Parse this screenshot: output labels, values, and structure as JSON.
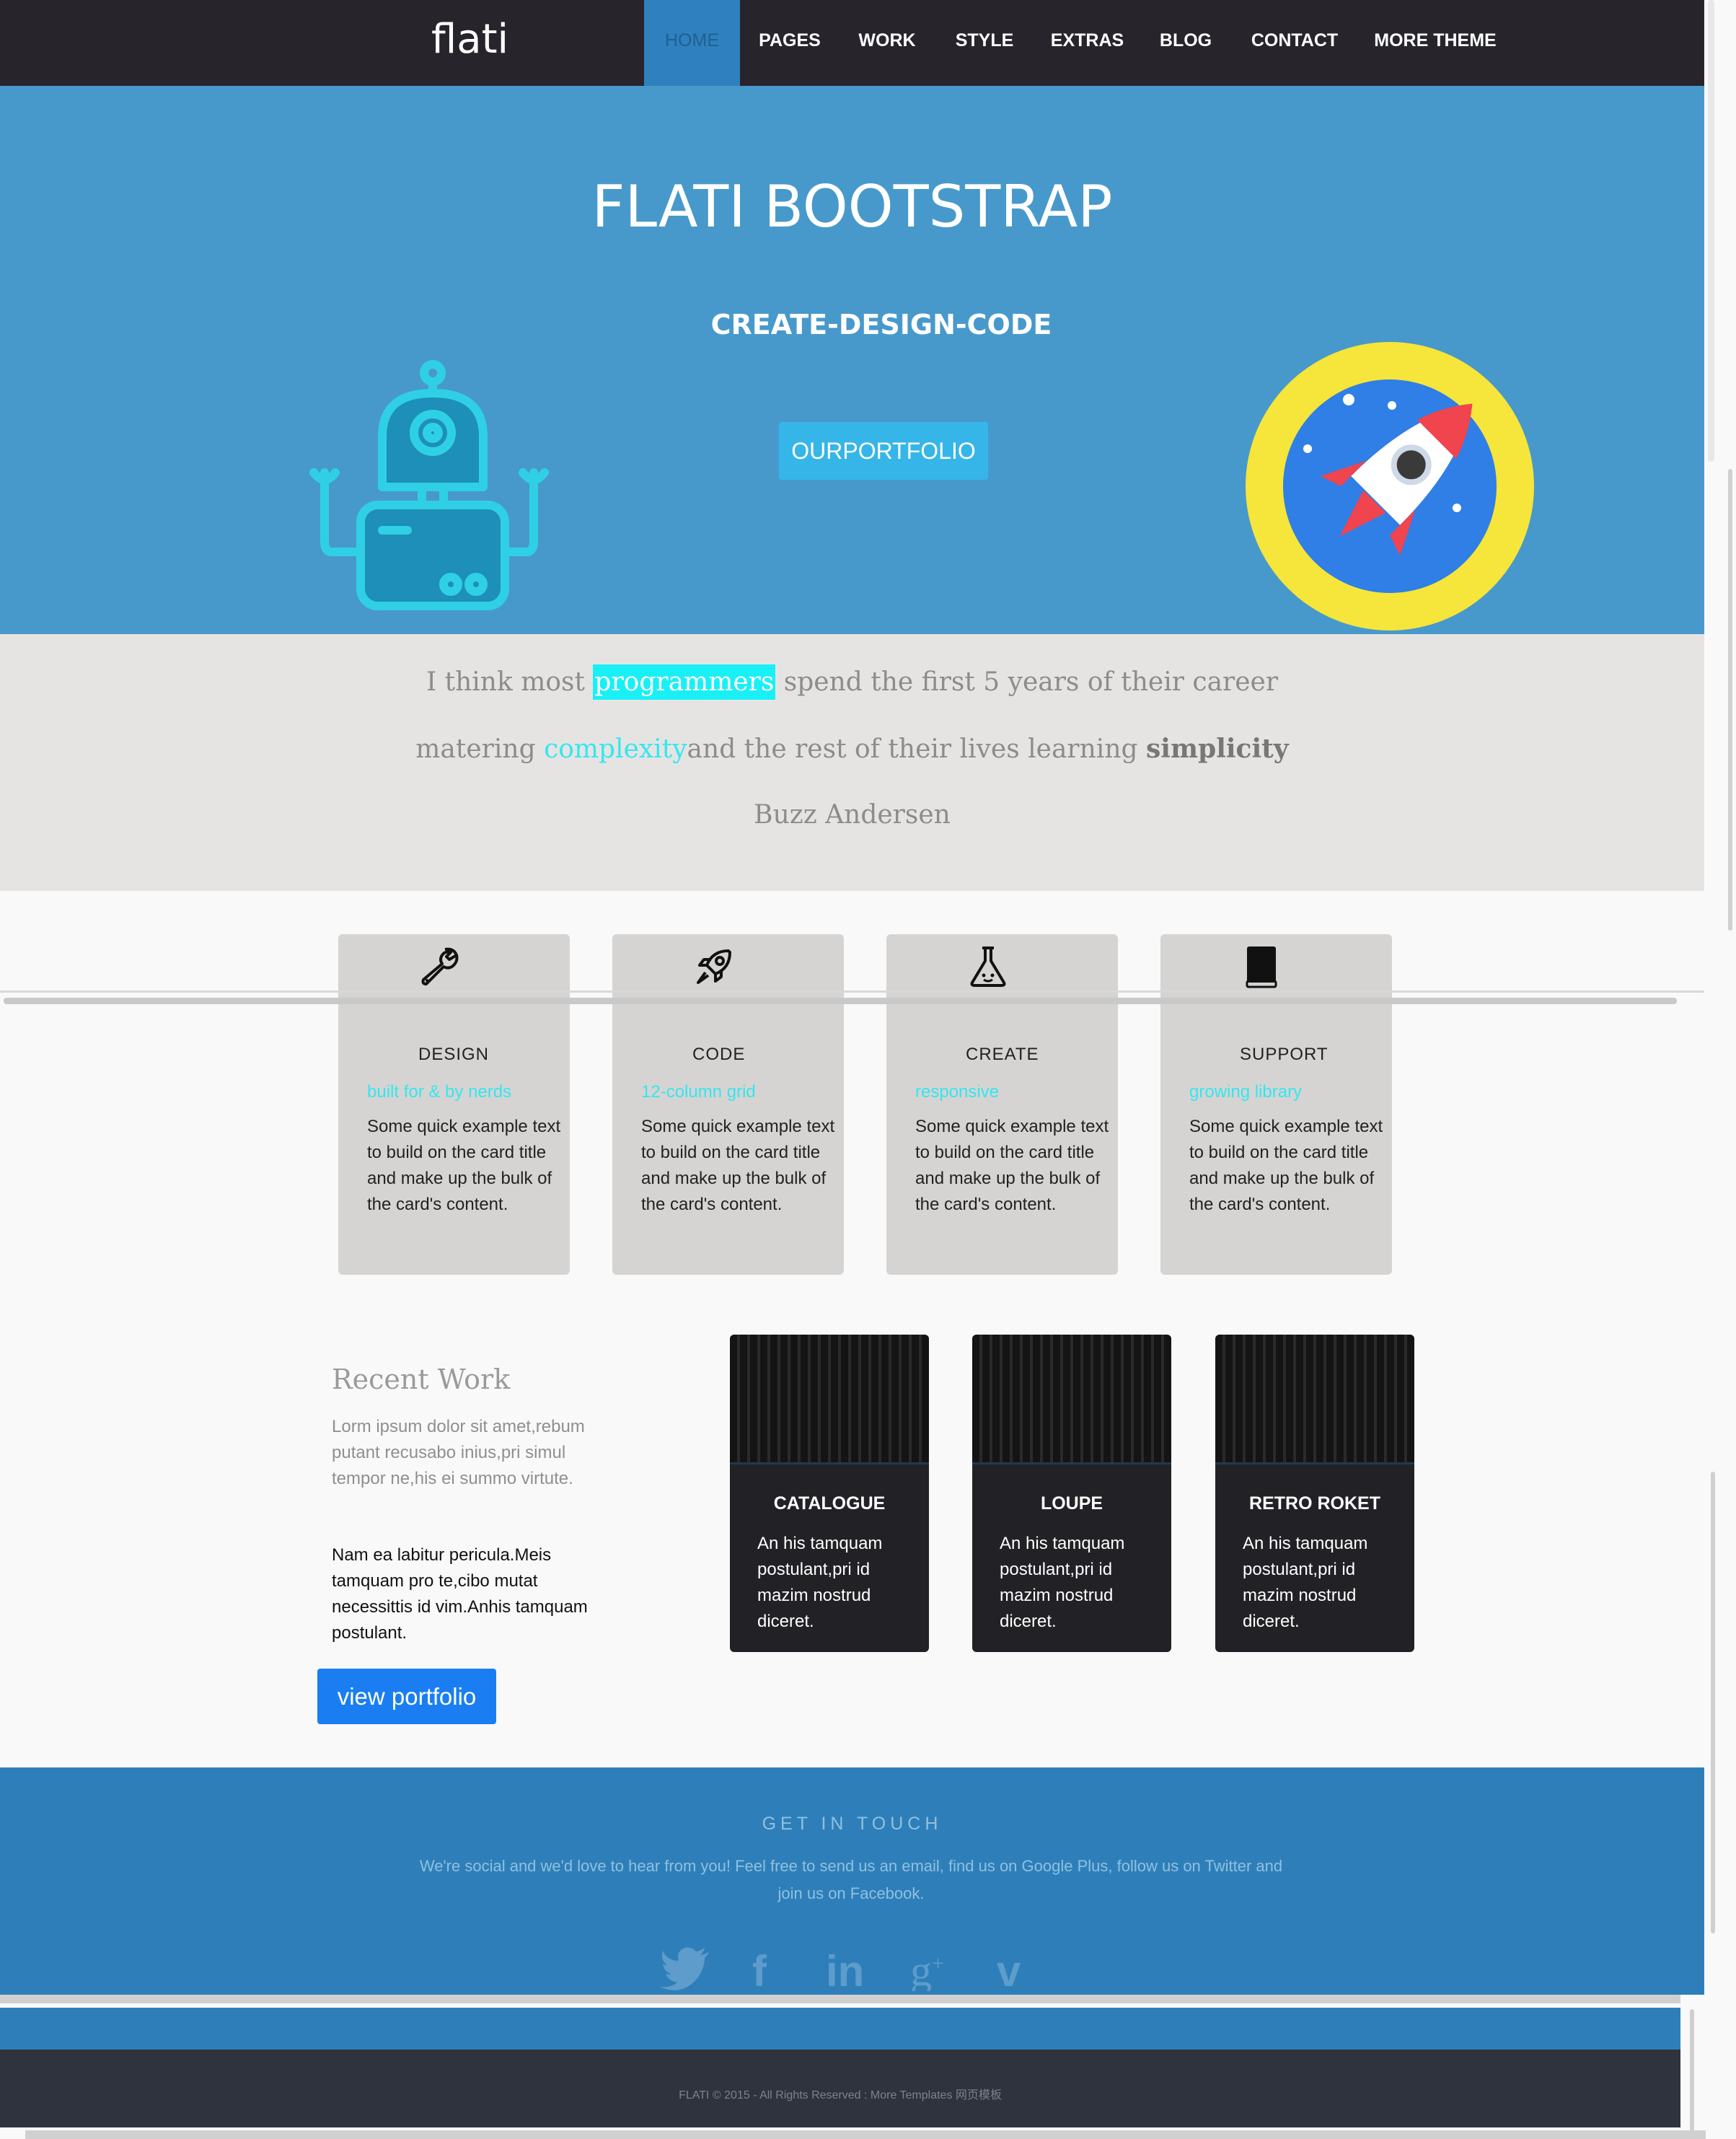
{
  "nav": {
    "brand": "flati",
    "items": [
      "HOME",
      "PAGES",
      "WORK",
      "STYLE",
      "EXTRAS",
      "BLOG",
      "CONTACT",
      "MORE THEME"
    ]
  },
  "hero": {
    "title": "FLATI BOOTSTRAP",
    "subtitle": "CREATE-DESIGN-CODE",
    "button": "OURPORTFOLIO"
  },
  "quote": {
    "l1_a": "I think most ",
    "l1_hl": "programmers",
    "l1_b": " spend the first 5 years of their career",
    "l2_a": "matering ",
    "l2_hl": "complexity",
    "l2_b": "and the rest of their lives learning ",
    "l2_bold": "simplicity",
    "author": "Buzz Andersen"
  },
  "features": [
    {
      "title": "DESIGN",
      "tag": "built for & by nerds",
      "text": "Some quick example text to build on the card title and make up the bulk of the card's content.",
      "icon": "wrench-icon"
    },
    {
      "title": "CODE",
      "tag": "12-column grid",
      "text": "Some quick example text to build on the card title and make up the bulk of the card's content.",
      "icon": "rocket-icon"
    },
    {
      "title": "CREATE",
      "tag": "responsive",
      "text": "Some quick example text to build on the card title and make up the bulk of the card's content.",
      "icon": "flask-icon"
    },
    {
      "title": "SUPPORT",
      "tag": "growing library",
      "text": "Some quick example text to build on the card title and make up the bulk of the card's content.",
      "icon": "book-icon"
    }
  ],
  "recent": {
    "title": "Recent Work",
    "p1": "Lorm ipsum dolor sit amet,rebum putant recusabo inius,pri simul tempor ne,his ei summo virtute.",
    "p2": "Nam ea labitur pericula.Meis tamquam pro te,cibo mutat necessittis id vim.Anhis tamquam postulant.",
    "button": "view portfolio"
  },
  "works": [
    {
      "title": "CATALOGUE",
      "text": "An his tamquam postulant,pri id mazim nostrud diceret."
    },
    {
      "title": "LOUPE",
      "text": "An his tamquam postulant,pri id mazim nostrud diceret."
    },
    {
      "title": "RETRO ROKET",
      "text": "An his tamquam postulant,pri id mazim nostrud diceret."
    }
  ],
  "contact": {
    "title": "GET IN TOUCH",
    "text": "We're social and we'd love to hear from you! Feel free to send us an email, find us on Google Plus, follow us on Twitter and join us on Facebook.",
    "icons": [
      "twitter-icon",
      "facebook-icon",
      "linkedin-icon",
      "google-plus-icon",
      "vimeo-icon"
    ]
  },
  "footer": {
    "text": "FLATI © 2015 - All Rights Reserved : More Templates 网页模板"
  },
  "colors": {
    "nav_bg": "#27252b",
    "hero_bg": "#4899cb",
    "accent_cyan": "#34e7f0",
    "contact_bg": "#2e7fb9",
    "footer_bg": "#2f333d"
  }
}
